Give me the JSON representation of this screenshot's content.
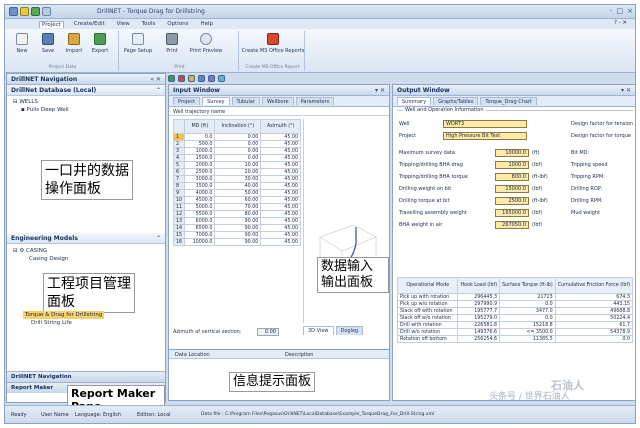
{
  "title_bar": {
    "title": "DrillNET - Torque Drag for Drillstring",
    "controls": [
      "-",
      "□",
      "×"
    ]
  },
  "menu": {
    "items": [
      "Project",
      "Create/Edit",
      "View",
      "Tools",
      "Options",
      "Help"
    ],
    "help": "? - ✕"
  },
  "ribbon": {
    "project_data": {
      "label": "Project Data",
      "buttons": [
        "New",
        "Save",
        "Import",
        "Export"
      ]
    },
    "print": {
      "label": "Print",
      "buttons": [
        "Page Setup",
        "Print",
        "Print Preview"
      ]
    },
    "report": {
      "label": "Create MS Office Report",
      "buttons": [
        "Create MS Office Reports"
      ]
    }
  },
  "nav": {
    "title": "DrillNET Navigation",
    "database_title": "DrillNet Database (Local)",
    "wells_label": "WELLS",
    "well_item": "Pulis Deep Well",
    "overlay_top": "一口井的数据\n操作面板",
    "engineering_title": "Engineering Models",
    "casing_label": "CASING",
    "casing_design": "Casing Design",
    "overlay_mid": "工程项目管理\n面板",
    "torque_item": "Torque & Drag for Drillstring",
    "drill_string_life": "Drill String Life",
    "nav_button": "DrillNET Navigation",
    "report_maker": "Report Maker",
    "report_pane_label": "Report Maker Pane"
  },
  "input_window": {
    "title": "Input Window",
    "tabs": [
      "Project",
      "Survey",
      "Tubular",
      "Wellbore",
      "Parameters"
    ],
    "wt_label": "Well trajectory name",
    "columns": [
      "MD (ft)",
      "Inclination (°)",
      "Azimuth (°)"
    ],
    "rows": [
      [
        "1",
        "0.0",
        "0.00",
        "45.00"
      ],
      [
        "2",
        "500.0",
        "0.00",
        "45.00"
      ],
      [
        "3",
        "1000.0",
        "0.00",
        "45.00"
      ],
      [
        "4",
        "1500.0",
        "0.00",
        "45.00"
      ],
      [
        "5",
        "2000.0",
        "10.00",
        "45.00"
      ],
      [
        "6",
        "2500.0",
        "20.00",
        "45.00"
      ],
      [
        "7",
        "3000.0",
        "30.00",
        "45.00"
      ],
      [
        "8",
        "3500.0",
        "40.00",
        "45.00"
      ],
      [
        "9",
        "4000.0",
        "50.00",
        "45.00"
      ],
      [
        "10",
        "4500.0",
        "60.00",
        "45.00"
      ],
      [
        "11",
        "5000.0",
        "70.00",
        "45.00"
      ],
      [
        "12",
        "5500.0",
        "80.00",
        "45.00"
      ],
      [
        "13",
        "6000.0",
        "90.00",
        "45.00"
      ],
      [
        "14",
        "6500.0",
        "90.00",
        "45.00"
      ],
      [
        "15",
        "7000.0",
        "90.00",
        "45.00"
      ],
      [
        "16",
        "10000.0",
        "90.00",
        "45.00"
      ]
    ],
    "overlay": "数据输入输出面板",
    "azimuth_label": "Azimuth of vertical section:",
    "azimuth_value": "0.00",
    "view_tabs": [
      "3D View",
      "Dogleg"
    ]
  },
  "info_window": {
    "columns": [
      "Data Location",
      "Description"
    ],
    "overlay": "信息提示面板"
  },
  "output_window": {
    "title": "Output Window",
    "tabs": [
      "Summary",
      "Graphs/Tables",
      "Torque_Drag Chart"
    ],
    "group_label": "Well and Operation Information",
    "well_label": "Well",
    "well_value": "WDRT3",
    "project_label": "Project",
    "project_value": "High Pressure Bit Test",
    "design_factor_1": "Design factor for tension",
    "design_factor_2": "Design factor for torque",
    "fields": [
      {
        "label": "Maximum survey data",
        "value": "10000.0",
        "unit": "(ft)",
        "right": "Bit MD:"
      },
      {
        "label": "Tripping/drilling BHA drag",
        "value": "1000.0",
        "unit": "(lbf)",
        "right": "Tripping speed"
      },
      {
        "label": "Tripping/drilling BHA torque",
        "value": "800.0",
        "unit": "(ft-lbf)",
        "right": "Tripping RPM:"
      },
      {
        "label": "Drilling weight on bit",
        "value": "15000.0",
        "unit": "(lbf)",
        "right": "Drilling ROP:"
      },
      {
        "label": "Drilling torque at bit",
        "value": "2500.0",
        "unit": "(ft-lbf)",
        "right": "Drilling RPM:"
      },
      {
        "label": "Travelling assembly weight",
        "value": "165000.0",
        "unit": "(lbf)",
        "right": "Mud weight"
      },
      {
        "label": "BHA weight in air",
        "value": "267050.0",
        "unit": "(lbf)",
        "right": ""
      }
    ],
    "results_columns": [
      "Operational Mode",
      "Hook Load (lbf)",
      "Surface Torque (ft-lb)",
      "Cumulative Friction Force (lbf)"
    ],
    "results_rows": [
      [
        "Pick up with rotation",
        "296445.3",
        "21723",
        "674.3"
      ],
      [
        "Pick up w/o rotation",
        "297990.9",
        "0.0",
        "443.15"
      ],
      [
        "Slack off with rotation",
        "195777.7",
        "3477.0",
        "49688.8"
      ],
      [
        "Slack off w/o rotation",
        "195279.0",
        "0.0",
        "50224.4"
      ],
      [
        "Drill with rotation",
        "226581.8",
        "15218.8",
        "61.7"
      ],
      [
        "Drill w/o rotation",
        "149376.6",
        "<= 3500.0",
        "54378.9"
      ],
      [
        "Rotation off bottom",
        "256254.6",
        "11385.5",
        "0.0"
      ]
    ]
  },
  "status_bar": {
    "ready": "Ready",
    "items": [
      "User Name",
      "Language: English",
      "Edition: Local"
    ],
    "path": "Data file : C:\\Program Files\\Pegasus\\DrillNET\\LocalDatabase\\Example_TorqueDrag_For_Drill-String.xml"
  },
  "watermark": {
    "top": "石油人",
    "bottom": "头条号 / 世界石油人"
  }
}
